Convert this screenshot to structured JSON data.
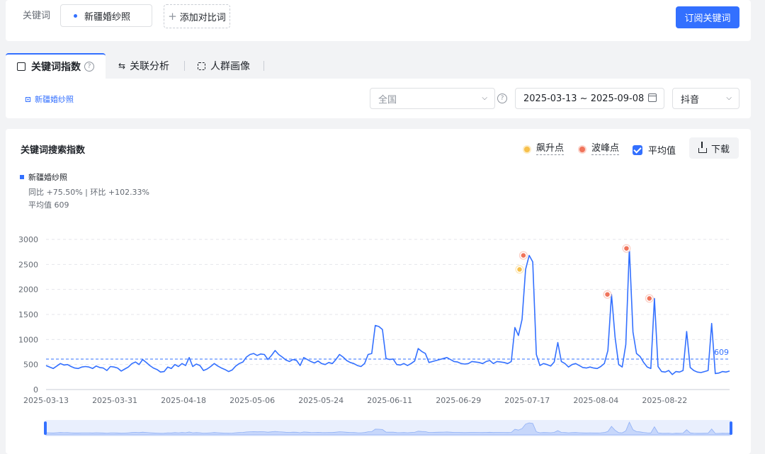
{
  "top": {
    "keyword_label": "关键词",
    "keyword_chip": "新疆婚纱照",
    "add_compare": "添加对比词",
    "subscribe": "订阅关键词"
  },
  "tabs": [
    {
      "label": "关键词指数",
      "active": true
    },
    {
      "label": "关联分析",
      "active": false
    },
    {
      "label": "人群画像",
      "active": false
    }
  ],
  "filters": {
    "keyword_legend": "新疆婚纱照",
    "region": "全国",
    "date_range": "2025-03-13 ~ 2025-09-08",
    "platform": "抖音"
  },
  "chart_panel": {
    "title": "关键词搜索指数",
    "surge_label": "飙升点",
    "peak_label": "波峰点",
    "avg_label": "平均值",
    "download": "下载",
    "series_name": "新疆婚纱照",
    "yoy_mom": "同比 +75.50% | 环比 +102.33%",
    "average_text": "平均值 609",
    "avg_tag": "609"
  },
  "colors": {
    "accent": "#3370ff",
    "surge": "#f7c04a",
    "peak": "#f0735a"
  },
  "chart_data": {
    "type": "line",
    "title": "关键词搜索指数",
    "x_start": "2025-03-13",
    "x_end": "2025-09-08",
    "x_ticks": [
      "2025-03-13",
      "2025-03-31",
      "2025-04-18",
      "2025-05-06",
      "2025-05-24",
      "2025-06-11",
      "2025-06-29",
      "2025-07-17",
      "2025-08-04",
      "2025-08-22"
    ],
    "y_ticks": [
      0,
      500,
      1000,
      1500,
      2000,
      2500,
      3000
    ],
    "ylim": [
      0,
      3000
    ],
    "average": 609,
    "series": [
      {
        "name": "新疆婚纱照",
        "values": [
          480,
          450,
          420,
          470,
          520,
          490,
          500,
          460,
          430,
          420,
          450,
          460,
          450,
          420,
          470,
          440,
          430,
          380,
          460,
          450,
          430,
          370,
          410,
          450,
          520,
          550,
          500,
          600,
          540,
          480,
          430,
          400,
          350,
          360,
          450,
          420,
          500,
          460,
          520,
          480,
          640,
          460,
          510,
          480,
          380,
          410,
          460,
          520,
          470,
          430,
          400,
          360,
          390,
          470,
          520,
          550,
          650,
          700,
          720,
          680,
          710,
          700,
          600,
          680,
          780,
          700,
          650,
          590,
          560,
          600,
          580,
          480,
          640,
          600,
          560,
          530,
          570,
          520,
          500,
          540,
          520,
          600,
          700,
          650,
          580,
          540,
          520,
          480,
          460,
          520,
          700,
          720,
          1280,
          1260,
          1200,
          620,
          600,
          610,
          500,
          490,
          520,
          480,
          520,
          570,
          820,
          760,
          720,
          540,
          560,
          580,
          600,
          620,
          640,
          600,
          560,
          550,
          520,
          510,
          520,
          560,
          550,
          540,
          520,
          560,
          580,
          520,
          560,
          550,
          540,
          520,
          560,
          1240,
          1080,
          1400,
          2400,
          2680,
          2550,
          700,
          480,
          520,
          500,
          470,
          550,
          940,
          560,
          520,
          450,
          500,
          520,
          480,
          440,
          430,
          450,
          430,
          420,
          460,
          520,
          780,
          1900,
          1050,
          500,
          450,
          900,
          2820,
          1150,
          720,
          660,
          540,
          450,
          420,
          1820,
          460,
          360,
          350,
          380,
          300,
          360,
          350,
          380,
          1160,
          440,
          380,
          350,
          340,
          360,
          380,
          1320,
          320,
          330,
          360,
          350,
          370
        ],
        "surge_points": [
          {
            "date": "2025-07-15",
            "value": 2400
          }
        ],
        "peak_points": [
          {
            "date": "2025-07-16",
            "value": 2680
          },
          {
            "date": "2025-08-07",
            "value": 1900
          },
          {
            "date": "2025-08-12",
            "value": 2820
          },
          {
            "date": "2025-08-18",
            "value": 1820
          }
        ]
      }
    ]
  }
}
